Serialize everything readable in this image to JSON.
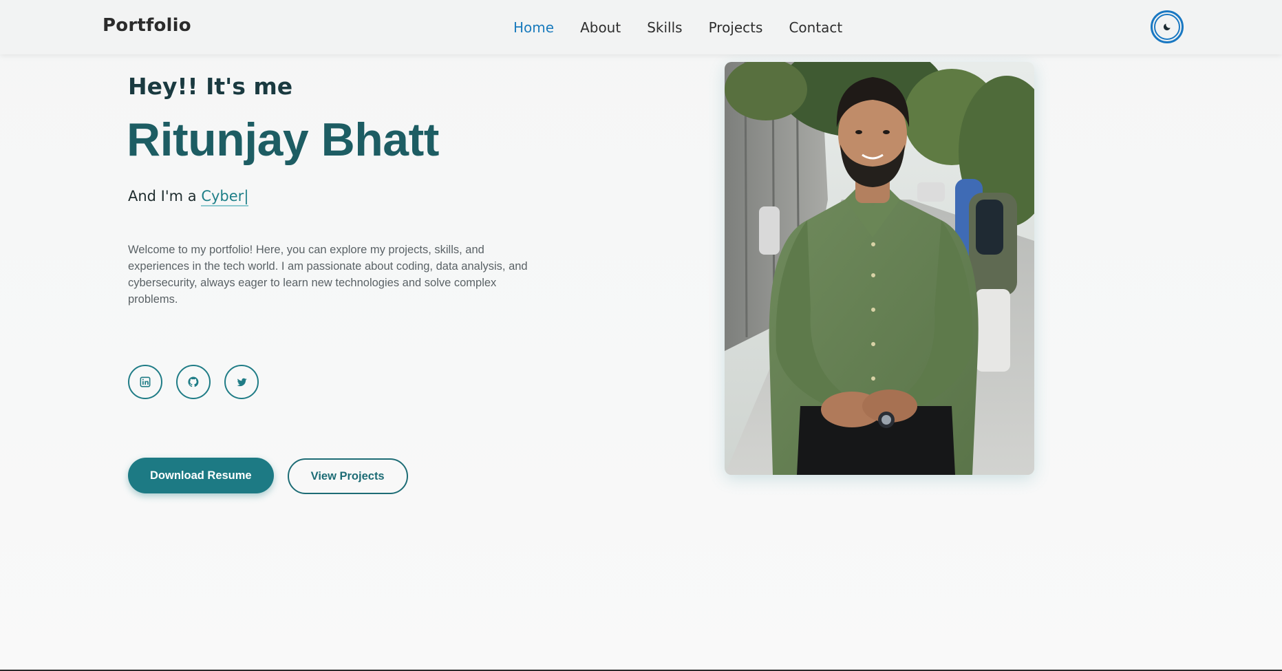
{
  "navbar": {
    "brand": "Portfolio",
    "links": [
      "Home",
      "About",
      "Skills",
      "Projects",
      "Contact"
    ],
    "active": "Home",
    "theme_toggle_icon": "moon-icon"
  },
  "hero": {
    "greeting": "Hey!! It's me",
    "name": "Ritunjay Bhatt",
    "role_prefix": "And I'm a ",
    "role_typed": "Cyber",
    "role_cursor": "|",
    "intro": "Welcome to my portfolio! Here, you can explore my projects, skills, and experiences in the tech world. I am passionate about coding, data analysis, and cybersecurity, always eager to learn new technologies and solve complex problems.",
    "socials": [
      {
        "icon": "linkedin-icon"
      },
      {
        "icon": "github-icon"
      },
      {
        "icon": "twitter-icon"
      }
    ],
    "buttons": {
      "download": "Download Resume",
      "projects": "View Projects"
    },
    "photo_icon": "profile-photo"
  },
  "colors": {
    "accent": "#1d7a84",
    "name": "#1d5d63",
    "nav_active": "#1a7bbd"
  }
}
